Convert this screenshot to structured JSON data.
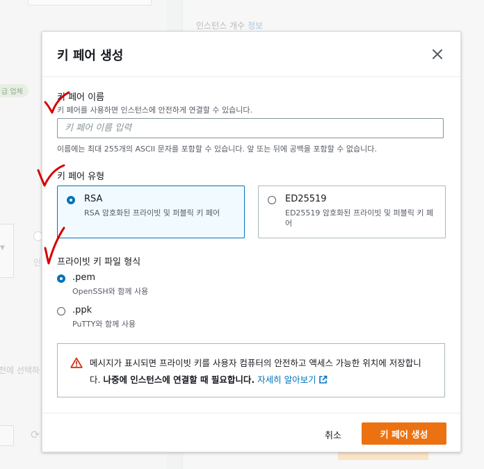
{
  "background": {
    "instance_count_label": "인스턴스 개수",
    "instance_count_info": "정보",
    "badge": "급 업체",
    "partial_text_1": "인",
    "partial_text_2": "전에 선택하",
    "refresh_glyph": "⟳"
  },
  "modal": {
    "title": "키 페어 생성",
    "name": {
      "label": "키 페어 이름",
      "description": "키 페어를 사용하면 인스턴스에 안전하게 연결할 수 있습니다.",
      "placeholder": "키 페어 이름 입력",
      "value": "",
      "constraint": "이름에는 최대 255개의 ASCII 문자를 포함할 수 있습니다. 앞 또는 뒤에 공백을 포함할 수 없습니다."
    },
    "key_type": {
      "label": "키 페어 유형",
      "selected": "RSA",
      "options": [
        {
          "title": "RSA",
          "description": "RSA 암호화된 프라이빗 및 퍼블릭 키 페어"
        },
        {
          "title": "ED25519",
          "description": "ED25519 암호화된 프라이빗 및 퍼블릭 키 페어"
        }
      ]
    },
    "file_format": {
      "label": "프라이빗 키 파일 형식",
      "selected": ".pem",
      "options": [
        {
          "title": ".pem",
          "description": "OpenSSH와 함께 사용"
        },
        {
          "title": ".ppk",
          "description": "PuTTY와 함께 사용"
        }
      ]
    },
    "alert": {
      "icon": "warning-icon",
      "text_normal": "메시지가 표시되면 프라이빗 키를 사용자 컴퓨터의 안전하고 액세스 가능한 위치에 저장합니다. ",
      "text_bold": "나중에 인스턴스에 연결할 때 필요합니다.",
      "link": "자세히 알아보기"
    },
    "footer": {
      "cancel_label": "취소",
      "create_label": "키 페어 생성"
    }
  },
  "colors": {
    "accent": "#0073bb",
    "primary_button": "#ec7211",
    "warning": "#d13212",
    "annotation_red": "#d40000"
  }
}
